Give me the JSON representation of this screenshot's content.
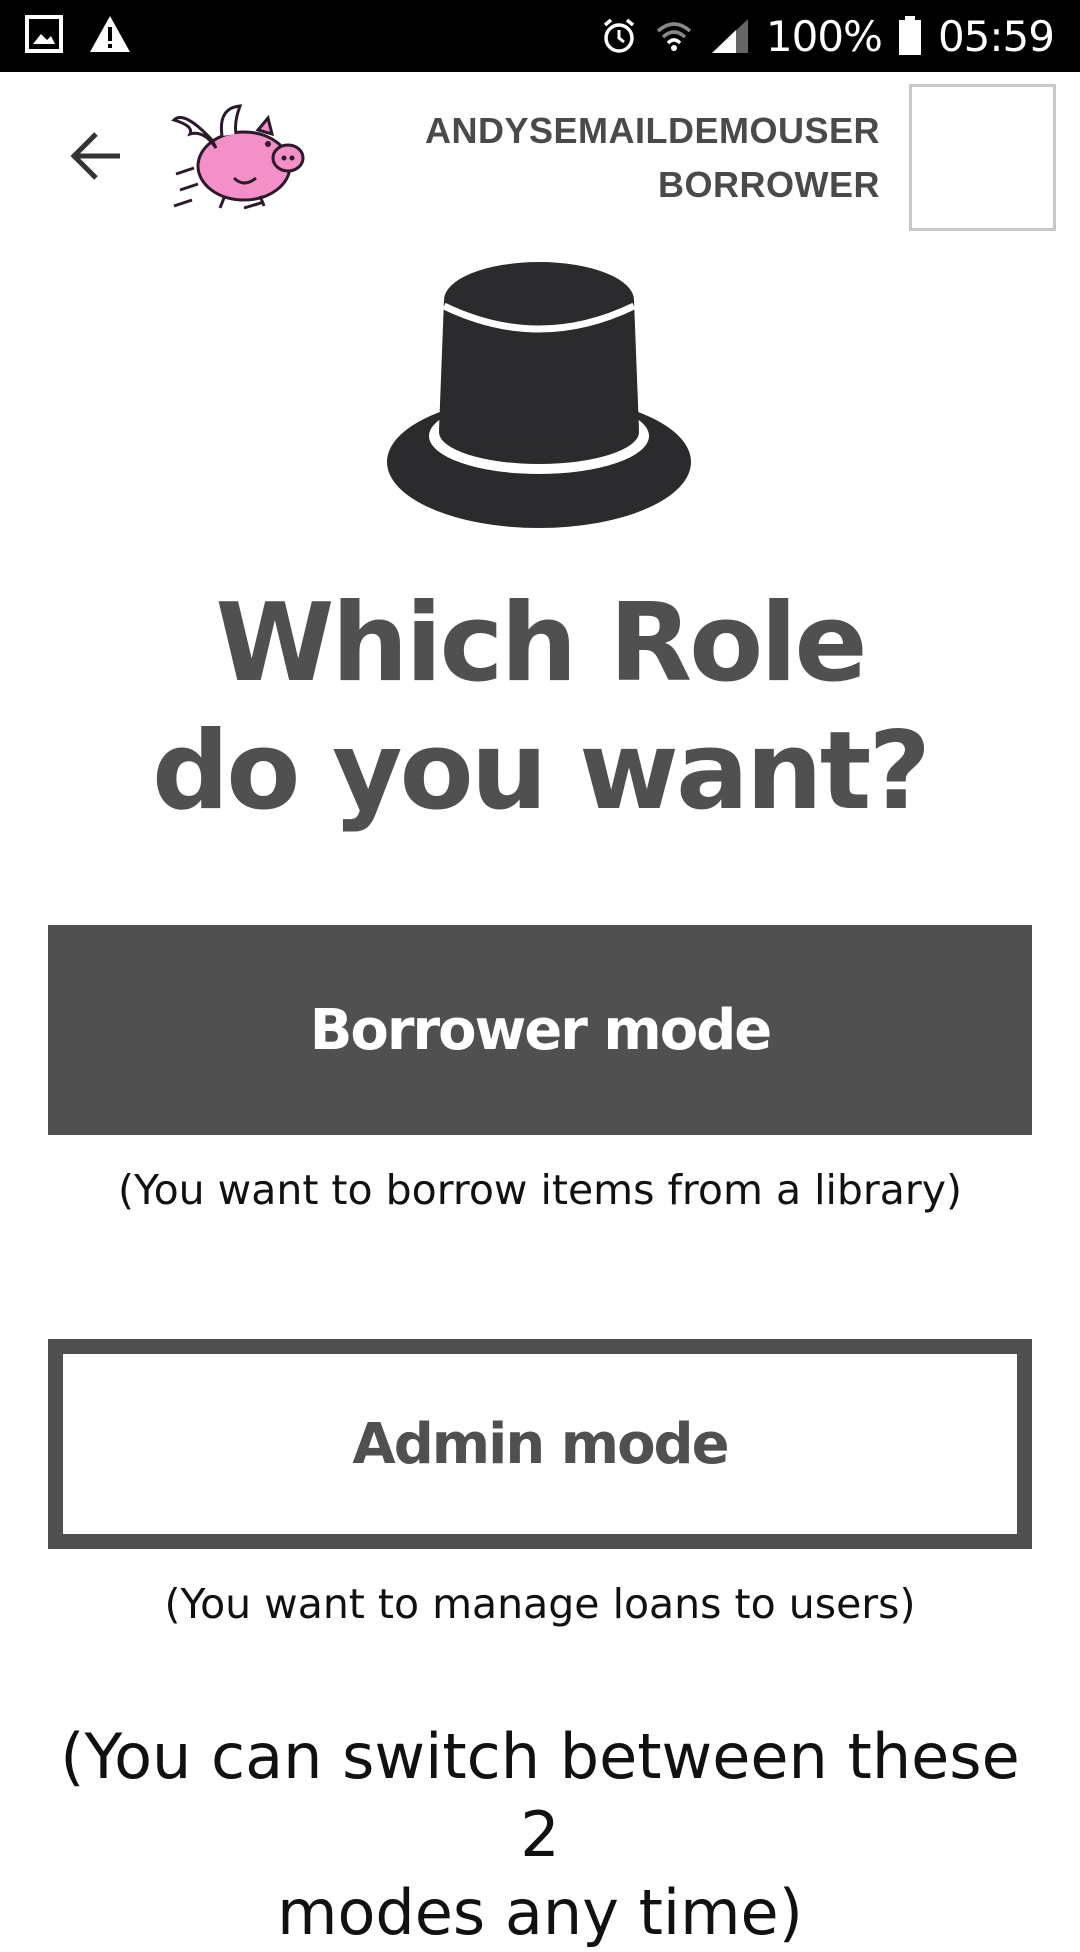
{
  "status_bar": {
    "battery": "100%",
    "time": "05:59",
    "icons": [
      "gallery-icon",
      "warning-icon",
      "alarm-icon",
      "wifi-icon",
      "signal-icon",
      "battery-icon"
    ]
  },
  "header": {
    "username": "ANDYSEMAILDEMOUSER",
    "role": "BORROWER",
    "icons": [
      "back-arrow-icon",
      "flying-pig-logo"
    ]
  },
  "main": {
    "title_line1": "Which Role",
    "title_line2": "do you want?",
    "borrower_button": "Borrower mode",
    "borrower_desc": "(You want to borrow items from a library)",
    "admin_button": "Admin mode",
    "admin_desc": "(You want to manage loans to users)",
    "switch_note_line1": "(You can switch between these 2",
    "switch_note_line2": "modes any time)"
  },
  "colors": {
    "primary_dark": "#505050",
    "status_bar": "#000000",
    "background": "#ffffff",
    "pig_pink": "#f48fc8"
  }
}
